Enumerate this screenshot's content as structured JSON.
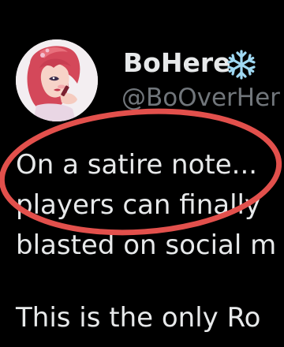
{
  "author": {
    "display_name": "BoHere",
    "handle": "@BoOverHer",
    "badge_icon": "snowflake-icon",
    "badge_color": "#9fd8f2",
    "avatar_icon": "anime-avatar-icon"
  },
  "tweet": {
    "lines": [
      "On a satire note...",
      "players can finally",
      "blasted on social m",
      "This is the only Ro"
    ]
  },
  "annotation": {
    "icon": "red-ellipse-highlight",
    "color": "#e2504c"
  }
}
